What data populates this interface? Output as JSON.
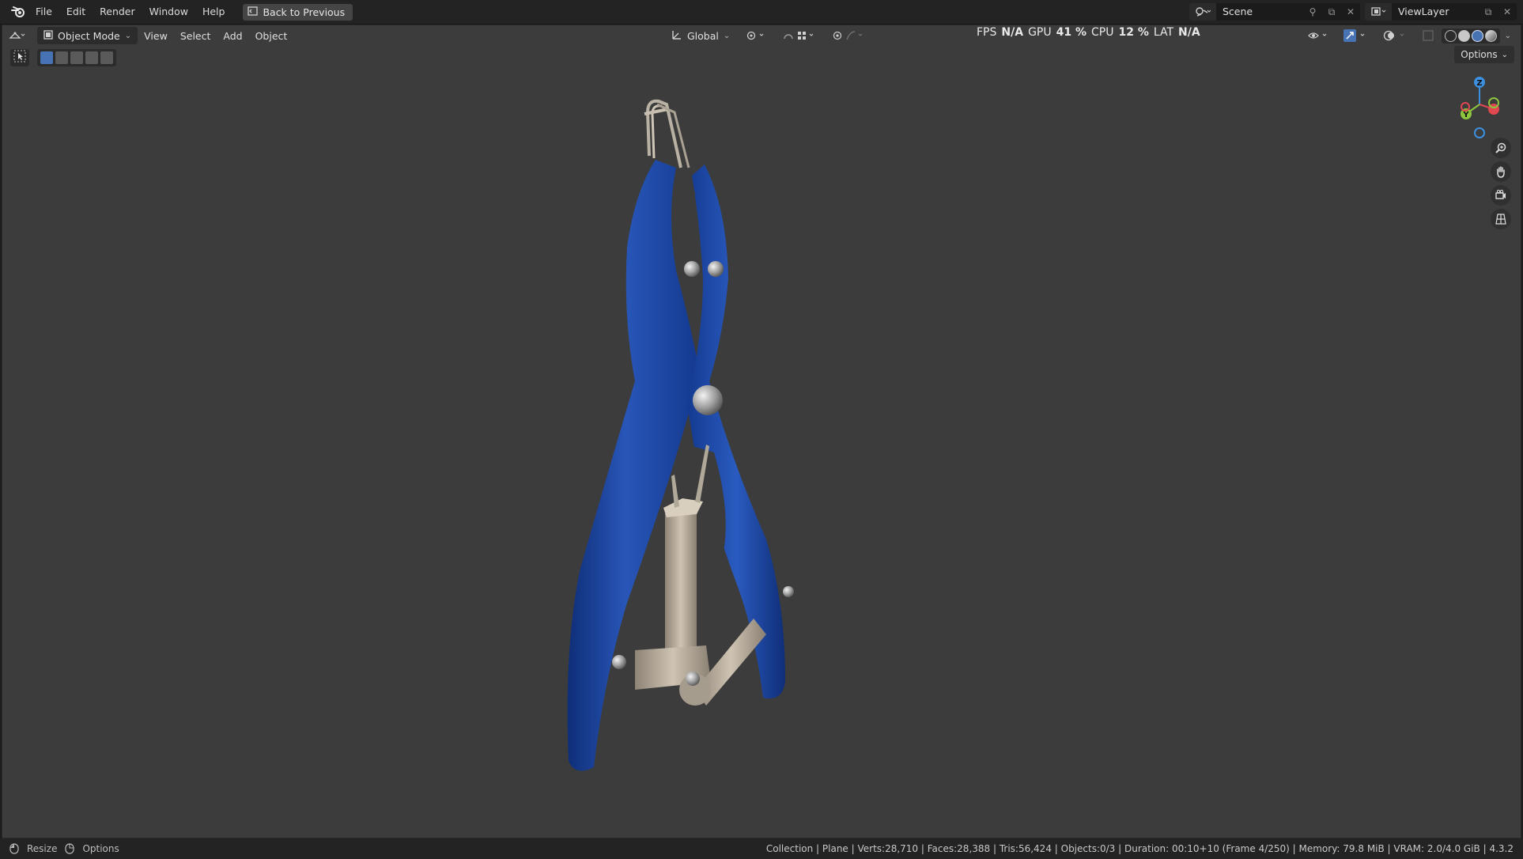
{
  "menubar": {
    "items": [
      "File",
      "Edit",
      "Render",
      "Window",
      "Help"
    ],
    "back_button": "Back to Previous"
  },
  "workspace": {
    "scene": "Scene",
    "view_layer": "ViewLayer"
  },
  "viewport_header": {
    "mode": "Object Mode",
    "menus": [
      "View",
      "Select",
      "Add",
      "Object"
    ],
    "transform_orientation": "Global",
    "options": "Options"
  },
  "stats": {
    "fps_label": "FPS",
    "fps_value": "N/A",
    "gpu_label": "GPU",
    "gpu_value": "41 %",
    "cpu_label": "CPU",
    "cpu_value": "12 %",
    "lat_label": "LAT",
    "lat_value": "N/A"
  },
  "gizmo": {
    "z": "Z",
    "y": "Y"
  },
  "statusbar": {
    "resize": "Resize",
    "options": "Options",
    "info": "Collection | Plane | Verts:28,710 | Faces:28,388 | Tris:56,424 | Objects:0/3 | Duration: 00:10+10 (Frame 4/250) | Memory: 79.8 MiB | VRAM: 2.0/4.0 GiB | 4.3.2"
  },
  "colors": {
    "viewport_bg": "#3c3c3c",
    "accent": "#4772b3",
    "model_blue": "#1f4aa8",
    "axis_x": "#e0474f",
    "axis_y": "#8cc63f",
    "axis_z": "#3d8fe0"
  }
}
